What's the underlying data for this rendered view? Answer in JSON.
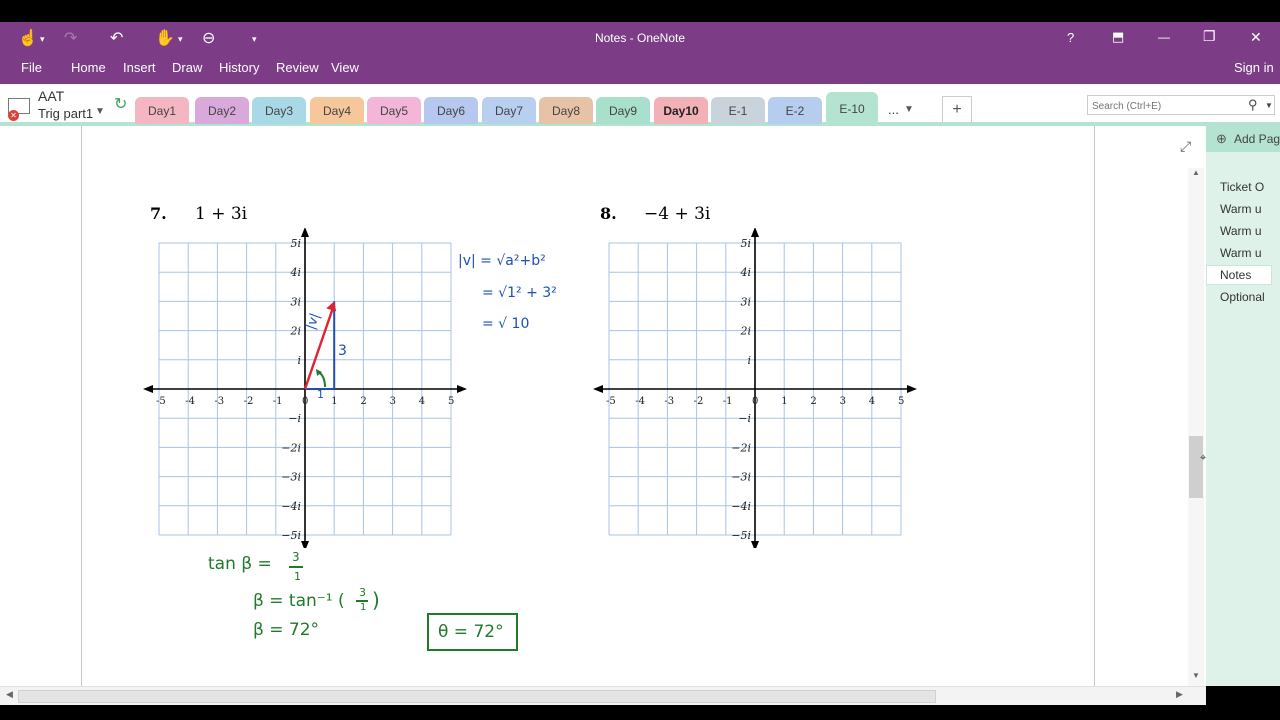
{
  "window": {
    "title": "Notes - OneNote",
    "controls": {
      "help": "?",
      "restore_ribbon": "⬒",
      "minimize": "—",
      "maximize": "❐",
      "close": "✕"
    }
  },
  "quick_access": {
    "touch_icon": "touch-mode-icon",
    "undo_icon": "undo-icon",
    "redo_icon": "redo-icon",
    "back_icon": "back-icon"
  },
  "ribbon": {
    "menus": [
      "File",
      "Home",
      "Insert",
      "Draw",
      "History",
      "Review",
      "View"
    ],
    "sign_in": "Sign in"
  },
  "notebook": {
    "name": "AAT",
    "section": "Trig part1"
  },
  "sections": [
    {
      "label": "Day1",
      "color": "#f4b6c2"
    },
    {
      "label": "Day2",
      "color": "#d9a9dc"
    },
    {
      "label": "Day3",
      "color": "#a9d8e6"
    },
    {
      "label": "Day4",
      "color": "#f5c79a"
    },
    {
      "label": "Day5",
      "color": "#f4b6d8"
    },
    {
      "label": "Day6",
      "color": "#b6c8ef"
    },
    {
      "label": "Day7",
      "color": "#b8cff0"
    },
    {
      "label": "Day8",
      "color": "#e6c3a6"
    },
    {
      "label": "Day9",
      "color": "#a8e0cc"
    },
    {
      "label": "Day10",
      "color": "#f1b1b6"
    },
    {
      "label": "E-1",
      "color": "#c9d3dc"
    },
    {
      "label": "E-2",
      "color": "#b6cdef"
    },
    {
      "label": "E-10",
      "color": "#b5e3d2"
    }
  ],
  "more_sections": "...",
  "add_section": "+",
  "search": {
    "placeholder": "Search (Ctrl+E)"
  },
  "page_pane": {
    "add_page": "Add Pag",
    "pages": [
      "Ticket O",
      "Warm u",
      "Warm u",
      "Warm u",
      "Notes",
      "Optional"
    ],
    "selected_index": 4
  },
  "problems": [
    {
      "number": "7.",
      "expression": "1 + 3i"
    },
    {
      "number": "8.",
      "expression": "−4 + 3i"
    }
  ],
  "grid": {
    "x_ticks": [
      "-5",
      "-4",
      "-3",
      "-2",
      "-1",
      "0",
      "1",
      "2",
      "3",
      "4",
      "5"
    ],
    "y_ticks_pos": [
      "5i",
      "4i",
      "3i",
      "2i",
      "i"
    ],
    "y_ticks_neg": [
      "−i",
      "−2i",
      "−3i",
      "−4i",
      "−5i"
    ],
    "vector_point": [
      1,
      3
    ]
  },
  "handwriting": {
    "magnitude_lines": [
      "|v| = √a²+b²",
      "= √1² + 3²",
      "= √ 10"
    ],
    "vector_label": "|v|",
    "side_label": "3",
    "base_label": "1",
    "tan_lines": [
      "tan β =",
      "β = tan⁻¹ (",
      "β = 72°"
    ],
    "fraction": {
      "num": "3",
      "den": "1"
    },
    "boxed_answer": "θ = 72°"
  }
}
